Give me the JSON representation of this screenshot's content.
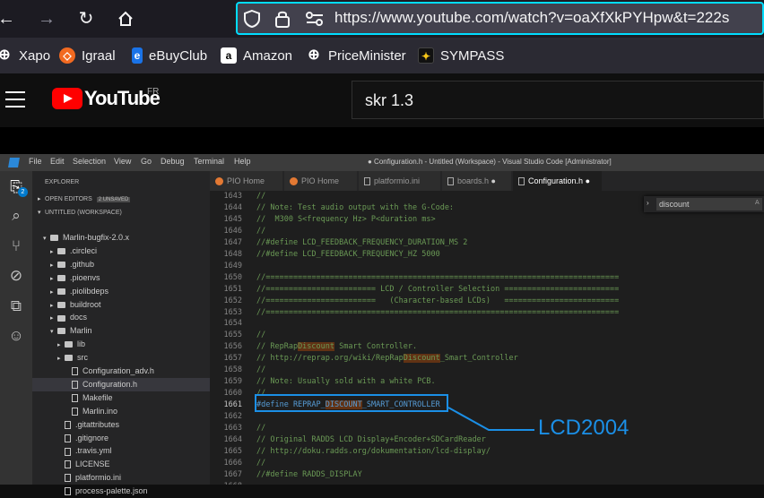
{
  "browser": {
    "url": "https://www.youtube.com/watch?v=oaXfXkPYHpw&t=222s",
    "bookmarks": [
      {
        "label": "Xapo",
        "icon": "globe-icon"
      },
      {
        "label": "Igraal",
        "icon": "igraal-icon"
      },
      {
        "label": "eBuyClub",
        "icon": "ebuyclub-icon"
      },
      {
        "label": "Amazon",
        "icon": "amazon-icon"
      },
      {
        "label": "PriceMinister",
        "icon": "globe-icon"
      },
      {
        "label": "SYMPASS",
        "icon": "sympass-icon"
      }
    ]
  },
  "youtube": {
    "logo_text": "YouTube",
    "country_code": "FR",
    "search_value": "skr 1.3"
  },
  "vscode": {
    "menu": [
      "File",
      "Edit",
      "Selection",
      "View",
      "Go",
      "Debug",
      "Terminal",
      "Help"
    ],
    "window_title": "● Configuration.h - Untitled (Workspace) - Visual Studio Code [Administrator]",
    "explorer_label": "EXPLORER",
    "open_editors": "OPEN EDITORS",
    "unsaved_badge": "2 UNSAVED",
    "workspace": "UNTITLED (WORKSPACE)",
    "badge_count": "2",
    "tree": [
      {
        "label": "Marlin-bugfix-2.0.x",
        "type": "folder-open",
        "depth": 1
      },
      {
        "label": ".circleci",
        "type": "folder",
        "depth": 2
      },
      {
        "label": ".github",
        "type": "folder",
        "depth": 2
      },
      {
        "label": ".pioenvs",
        "type": "folder",
        "depth": 2
      },
      {
        "label": ".piolibdeps",
        "type": "folder",
        "depth": 2
      },
      {
        "label": "buildroot",
        "type": "folder",
        "depth": 2
      },
      {
        "label": "docs",
        "type": "folder",
        "depth": 2
      },
      {
        "label": "Marlin",
        "type": "folder-open",
        "depth": 2
      },
      {
        "label": "lib",
        "type": "folder",
        "depth": 3
      },
      {
        "label": "src",
        "type": "folder",
        "depth": 3
      },
      {
        "label": "Configuration_adv.h",
        "type": "file",
        "depth": 3
      },
      {
        "label": "Configuration.h",
        "type": "file",
        "depth": 3
      },
      {
        "label": "Makefile",
        "type": "file",
        "depth": 3
      },
      {
        "label": "Marlin.ino",
        "type": "file",
        "depth": 3
      },
      {
        "label": ".gitattributes",
        "type": "file",
        "depth": 2
      },
      {
        "label": ".gitignore",
        "type": "file",
        "depth": 2
      },
      {
        "label": ".travis.yml",
        "type": "file",
        "depth": 2
      },
      {
        "label": "LICENSE",
        "type": "file",
        "depth": 2
      },
      {
        "label": "platformio.ini",
        "type": "file",
        "depth": 2
      },
      {
        "label": "process-palette.json",
        "type": "file",
        "depth": 2
      }
    ],
    "tabs": [
      {
        "label": "PIO Home",
        "icon": "pio"
      },
      {
        "label": "PIO Home",
        "icon": "pio"
      },
      {
        "label": "platformio.ini",
        "icon": "file"
      },
      {
        "label": "boards.h",
        "icon": "file"
      },
      {
        "label": "Configuration.h",
        "icon": "file"
      }
    ],
    "find_value": "discount",
    "find_count": "A",
    "lines": [
      {
        "n": "1643",
        "t": "//"
      },
      {
        "n": "1644",
        "t": "// Note: Test audio output with the G-Code:"
      },
      {
        "n": "1645",
        "t": "//  M300 S<frequency Hz> P<duration ms>"
      },
      {
        "n": "1646",
        "t": "//"
      },
      {
        "n": "1647",
        "t": "//#define LCD_FEEDBACK_FREQUENCY_DURATION_MS 2"
      },
      {
        "n": "1648",
        "t": "//#define LCD_FEEDBACK_FREQUENCY_HZ 5000"
      },
      {
        "n": "1649",
        "t": ""
      },
      {
        "n": "1650",
        "t": "//============================================================================="
      },
      {
        "n": "1651",
        "t": "//======================== LCD / Controller Selection ========================="
      },
      {
        "n": "1652",
        "t": "//========================   (Character-based LCDs)   ========================="
      },
      {
        "n": "1653",
        "t": "//============================================================================="
      },
      {
        "n": "1654",
        "t": ""
      },
      {
        "n": "1655",
        "t": "//"
      },
      {
        "n": "1656",
        "t": "// RepRapDiscount Smart Controller."
      },
      {
        "n": "1657",
        "t": "// http://reprap.org/wiki/RepRapDiscount_Smart_Controller"
      },
      {
        "n": "1658",
        "t": "//"
      },
      {
        "n": "1659",
        "t": "// Note: Usually sold with a white PCB."
      },
      {
        "n": "1660",
        "t": "//"
      },
      {
        "n": "1661",
        "t": "#define REPRAP_DISCOUNT_SMART_CONTROLLER"
      },
      {
        "n": "1662",
        "t": ""
      },
      {
        "n": "1663",
        "t": "//"
      },
      {
        "n": "1664",
        "t": "// Original RADDS LCD Display+Encoder+SDCardReader"
      },
      {
        "n": "1665",
        "t": "// http://doku.radds.org/dokumentation/lcd-display/"
      },
      {
        "n": "1666",
        "t": "//"
      },
      {
        "n": "1667",
        "t": "//#define RADDS_DISPLAY"
      },
      {
        "n": "1668",
        "t": ""
      }
    ]
  },
  "annotation": {
    "callout": "LCD2004",
    "color": "#1b8fe6"
  }
}
